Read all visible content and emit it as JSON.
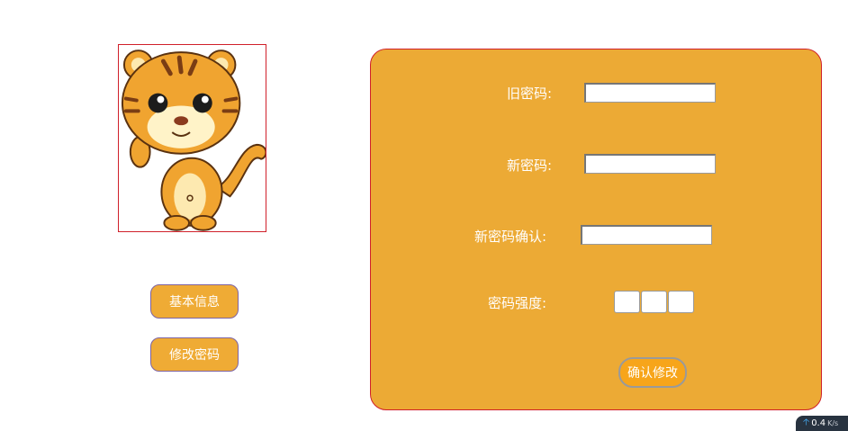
{
  "sidebar": {
    "basic_info_label": "基本信息",
    "change_password_label": "修改密码"
  },
  "form": {
    "old_password_label": "旧密码:",
    "new_password_label": "新密码:",
    "confirm_password_label": "新密码确认:",
    "strength_label": "密码强度:",
    "submit_label": "确认修改"
  },
  "status": {
    "net_speed": "0.4",
    "net_speed_unit": "K/s"
  },
  "colors": {
    "panel": "#ecaa35",
    "button": "#efab35",
    "border_accent": "#d0202a"
  }
}
